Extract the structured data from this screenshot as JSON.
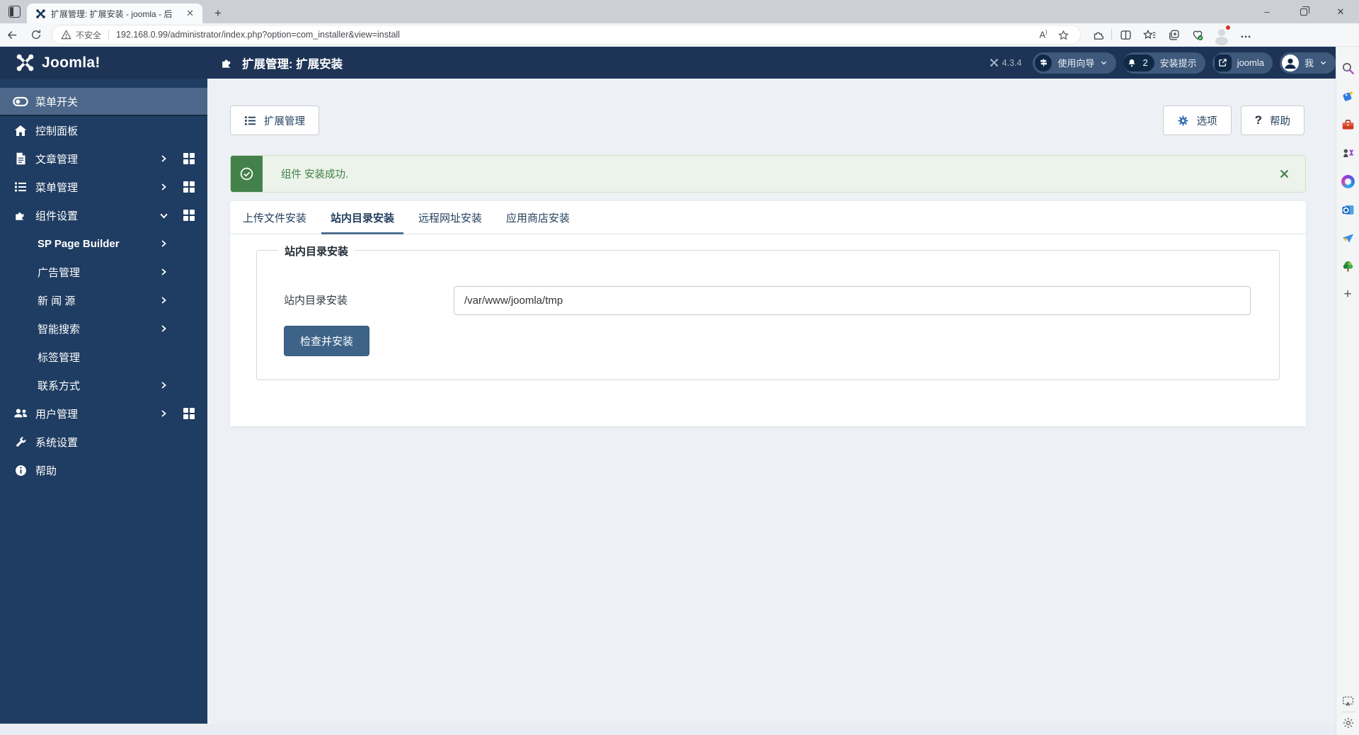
{
  "browser": {
    "tab_title": "扩展管理: 扩展安装 - joomla - 后",
    "tab_close": "✕",
    "new_tab": "+",
    "security_label": "不安全",
    "url": "192.168.0.99/administrator/index.php?option=com_installer&view=install",
    "minimize": "–",
    "close": "✕",
    "more": "…",
    "read_aloud": "A"
  },
  "admin_header": {
    "logo_text": "Joomla!",
    "page_title": "扩展管理: 扩展安装",
    "version": "4.3.4",
    "guide_label": "使用向导",
    "notifications_count": "2",
    "notifications_label": "安装提示",
    "site_link_label": "joomla",
    "account_label": "我"
  },
  "sidebar": {
    "items": [
      {
        "label": "菜单开关"
      },
      {
        "label": "控制面板"
      },
      {
        "label": "文章管理"
      },
      {
        "label": "菜单管理"
      },
      {
        "label": "组件设置"
      },
      {
        "label": "SP Page Builder"
      },
      {
        "label": "广告管理"
      },
      {
        "label": "新 闻 源"
      },
      {
        "label": "智能搜索"
      },
      {
        "label": "标签管理"
      },
      {
        "label": "联系方式"
      },
      {
        "label": "用户管理"
      },
      {
        "label": "系统设置"
      },
      {
        "label": "帮助"
      }
    ]
  },
  "toolbar": {
    "back_label": "扩展管理",
    "options_label": "选项",
    "help_label": "帮助"
  },
  "alert": {
    "message": "组件 安装成功."
  },
  "tabs": [
    {
      "label": "上传文件安装"
    },
    {
      "label": "站内目录安装"
    },
    {
      "label": "远程网址安装"
    },
    {
      "label": "应用商店安装"
    }
  ],
  "form": {
    "legend": "站内目录安装",
    "field_label": "站内目录安装",
    "field_value": "/var/www/joomla/tmp",
    "submit_label": "检查并安装"
  },
  "colors": {
    "header_navy": "#1d3456",
    "sidebar_navy": "#1f3c62",
    "active_item": "#4c6789",
    "primary_button": "#3e6389",
    "success_green": "#44814a",
    "options_gear_blue": "#2e6db2"
  }
}
